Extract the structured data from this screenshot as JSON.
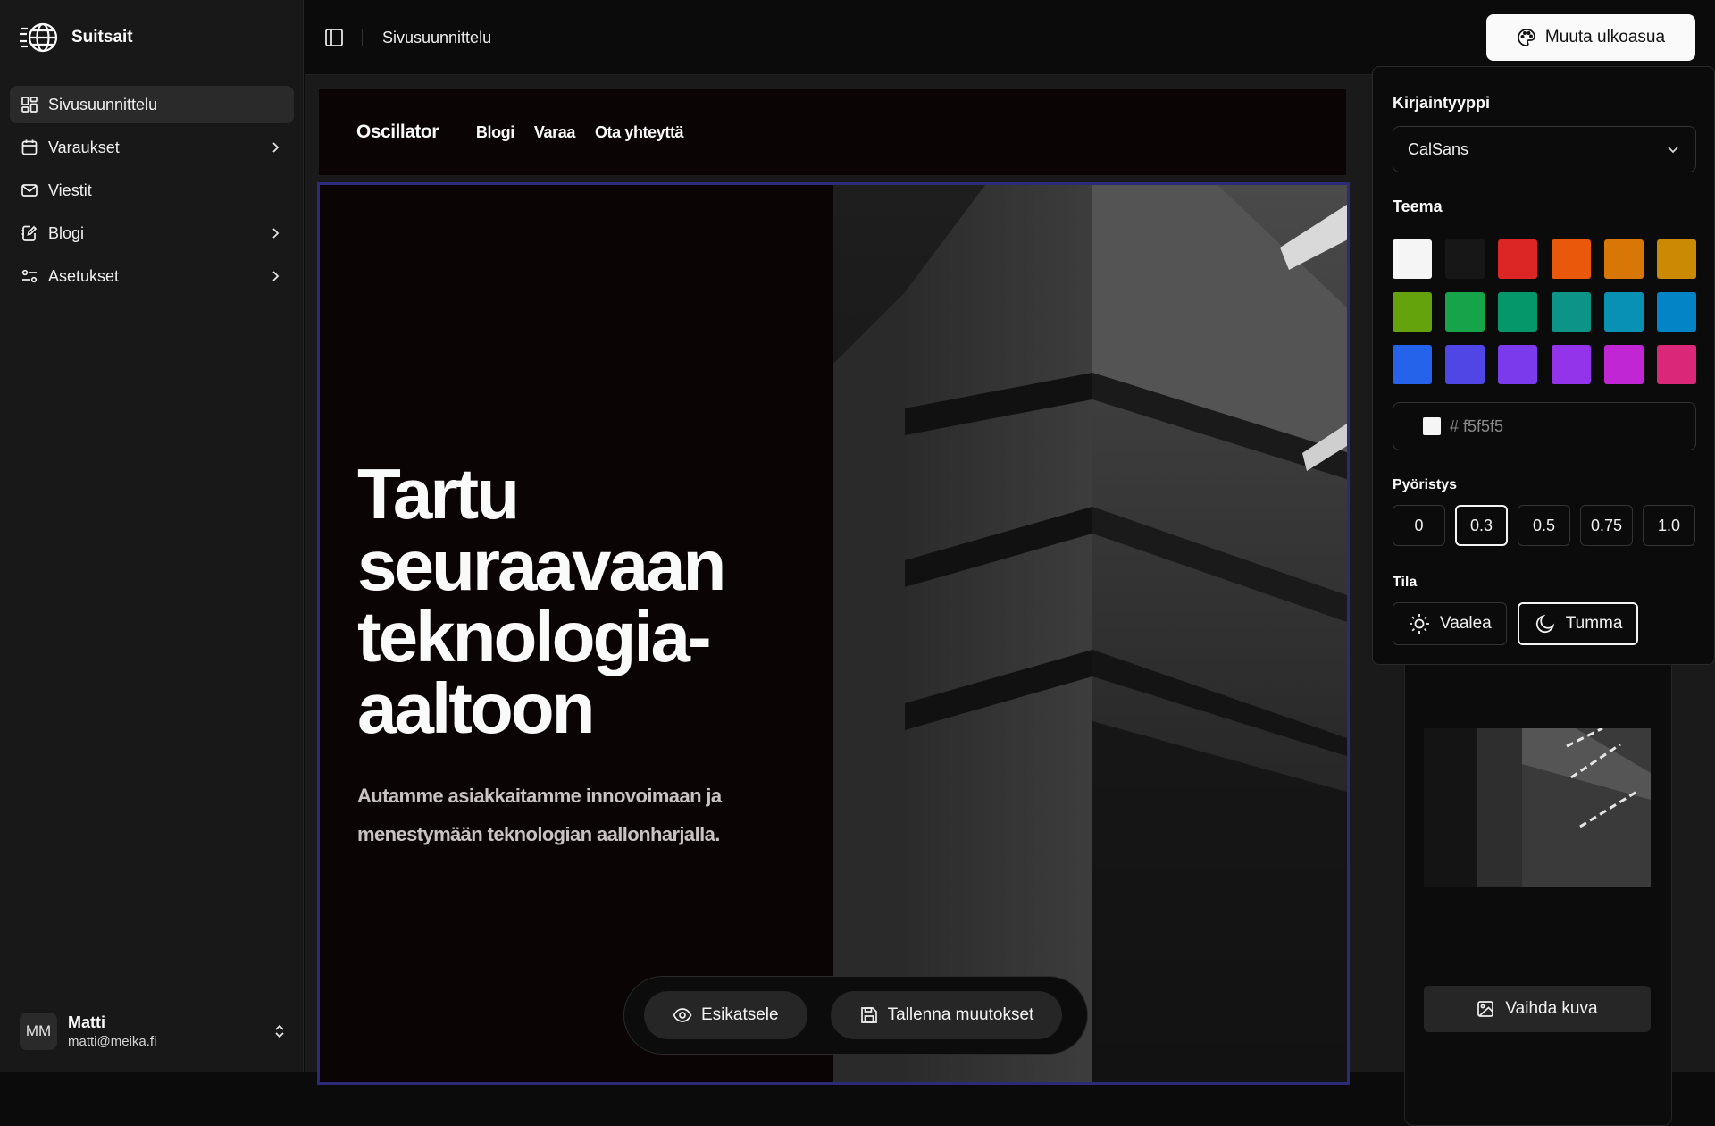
{
  "app": {
    "name": "Suitsait"
  },
  "sidebar": {
    "items": [
      {
        "label": "Sivusuunnittelu",
        "icon": "layout-dashboard-icon",
        "active": true,
        "chevron": false
      },
      {
        "label": "Varaukset",
        "icon": "calendar-icon",
        "active": false,
        "chevron": true
      },
      {
        "label": "Viestit",
        "icon": "mail-icon",
        "active": false,
        "chevron": false
      },
      {
        "label": "Blogi",
        "icon": "notebook-pen-icon",
        "active": false,
        "chevron": true
      },
      {
        "label": "Asetukset",
        "icon": "settings-sliders-icon",
        "active": false,
        "chevron": true
      }
    ],
    "user": {
      "initials": "MM",
      "name": "Matti",
      "email": "matti@meika.fi"
    }
  },
  "topbar": {
    "breadcrumb": "Sivusuunnittelu",
    "appearance_button": "Muuta ulkoasua"
  },
  "preview": {
    "nav": {
      "logo": "Oscillator",
      "links": [
        "Blogi",
        "Varaa",
        "Ota yhteyttä"
      ]
    },
    "hero": {
      "title_lines": [
        "Tartu",
        "seuraavaan",
        "teknologia-",
        "aaltoon"
      ],
      "subtitle_lines": [
        "Autamme asiakkaitamme innovoimaan ja",
        "menestymään teknologian aallonharjalla."
      ]
    },
    "actions": {
      "preview": "Esikatsele",
      "save": "Tallenna muutokset"
    },
    "side_card": {
      "change_image": "Vaihda kuva"
    }
  },
  "appearance": {
    "font_label": "Kirjaintyyppi",
    "font_value": "CalSans",
    "theme_label": "Teema",
    "theme_colors": [
      "#f5f5f5",
      "#171717",
      "#dc2626",
      "#ea580c",
      "#d97706",
      "#ca8a04",
      "#65a30d",
      "#16a34a",
      "#059669",
      "#0d9488",
      "#0891b2",
      "#0284c7",
      "#2563eb",
      "#4f46e5",
      "#7c3aed",
      "#9333ea",
      "#c026d3",
      "#db2777"
    ],
    "custom_color": "# f5f5f5",
    "radius_label": "Pyöristys",
    "radius_options": [
      "0",
      "0.3",
      "0.5",
      "0.75",
      "1.0"
    ],
    "radius_selected": "0.3",
    "mode_label": "Tila",
    "modes": [
      {
        "label": "Vaalea",
        "icon": "sun-icon",
        "selected": false
      },
      {
        "label": "Tumma",
        "icon": "moon-icon",
        "selected": true
      }
    ]
  }
}
